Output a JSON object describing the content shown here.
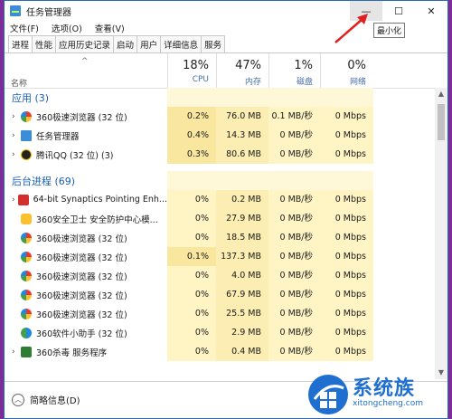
{
  "window": {
    "title": "任务管理器"
  },
  "controls": {
    "minimize": "—",
    "maximize": "☐",
    "close": "✕",
    "tooltip": "最小化"
  },
  "menu": [
    "文件(F)",
    "选项(O)",
    "查看(V)"
  ],
  "tabs": [
    "进程",
    "性能",
    "应用历史记录",
    "启动",
    "用户",
    "详细信息",
    "服务"
  ],
  "header": {
    "name_label": "名称",
    "columns": [
      {
        "pct": "18%",
        "label": "CPU"
      },
      {
        "pct": "47%",
        "label": "内存"
      },
      {
        "pct": "1%",
        "label": "磁盘"
      },
      {
        "pct": "0%",
        "label": "网络"
      }
    ]
  },
  "groups": {
    "apps": "应用 (3)",
    "background": "后台进程 (69)"
  },
  "apps": [
    {
      "name": "360极速浏览器 (32 位)",
      "icon": "chrome-360-icon",
      "cpu": "0.2%",
      "mem": "76.0 MB",
      "disk": "0.1 MB/秒",
      "net": "0 Mbps",
      "expand": true
    },
    {
      "name": "任务管理器",
      "icon": "task-manager-icon",
      "cpu": "0.4%",
      "mem": "14.3 MB",
      "disk": "0 MB/秒",
      "net": "0 Mbps",
      "expand": true
    },
    {
      "name": "腾讯QQ (32 位) (3)",
      "icon": "qq-icon",
      "cpu": "0.3%",
      "mem": "80.6 MB",
      "disk": "0 MB/秒",
      "net": "0 Mbps",
      "expand": true
    }
  ],
  "background": [
    {
      "name": "64-bit Synaptics Pointing Enh...",
      "icon": "synaptics-icon",
      "cpu": "0%",
      "mem": "0.2 MB",
      "disk": "0 MB/秒",
      "net": "0 Mbps",
      "expand": true
    },
    {
      "name": "360安全卫士 安全防护中心模...",
      "icon": "360-shield-icon",
      "cpu": "0%",
      "mem": "27.9 MB",
      "disk": "0 MB/秒",
      "net": "0 Mbps",
      "expand": false
    },
    {
      "name": "360极速浏览器 (32 位)",
      "icon": "chrome-360-icon",
      "cpu": "0%",
      "mem": "18.5 MB",
      "disk": "0 MB/秒",
      "net": "0 Mbps",
      "expand": false
    },
    {
      "name": "360极速浏览器 (32 位)",
      "icon": "chrome-360-icon",
      "cpu": "0.1%",
      "mem": "137.3 MB",
      "disk": "0 MB/秒",
      "net": "0 Mbps",
      "expand": false
    },
    {
      "name": "360极速浏览器 (32 位)",
      "icon": "chrome-360-icon",
      "cpu": "0%",
      "mem": "4.0 MB",
      "disk": "0 MB/秒",
      "net": "0 Mbps",
      "expand": false
    },
    {
      "name": "360极速浏览器 (32 位)",
      "icon": "chrome-360-icon",
      "cpu": "0%",
      "mem": "67.9 MB",
      "disk": "0 MB/秒",
      "net": "0 Mbps",
      "expand": false
    },
    {
      "name": "360极速浏览器 (32 位)",
      "icon": "chrome-360-icon",
      "cpu": "0%",
      "mem": "25.5 MB",
      "disk": "0 MB/秒",
      "net": "0 Mbps",
      "expand": false
    },
    {
      "name": "360软件小助手 (32 位)",
      "icon": "360-helper-icon",
      "cpu": "0%",
      "mem": "2.9 MB",
      "disk": "0 MB/秒",
      "net": "0 Mbps",
      "expand": false
    },
    {
      "name": "360杀毒 服务程序",
      "icon": "360-antivirus-icon",
      "cpu": "0%",
      "mem": "0.4 MB",
      "disk": "0 MB/秒",
      "net": "0 Mbps",
      "expand": true
    }
  ],
  "footer": {
    "less_details": "简略信息(D)"
  },
  "watermark": {
    "brand": "系统族",
    "url": "xitongcheng.com"
  },
  "colors": {
    "accent": "#1a5fb4",
    "highlight": "#fff4c4",
    "background": "#7b2d9b"
  }
}
